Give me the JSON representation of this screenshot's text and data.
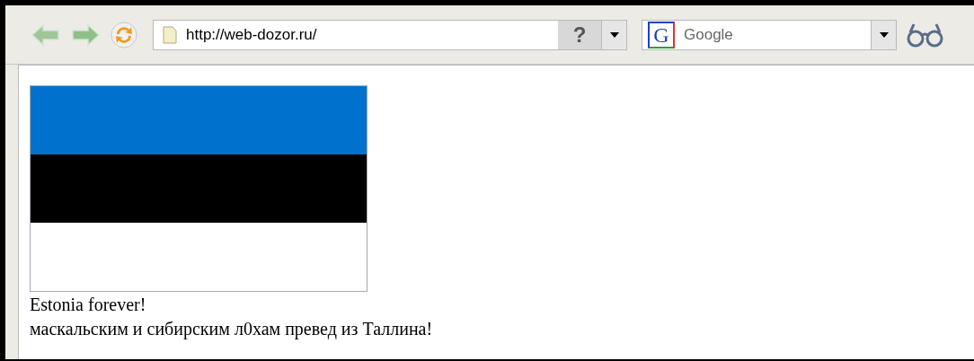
{
  "toolbar": {
    "address": "http://web-dozor.ru/",
    "help_glyph": "?",
    "search": {
      "logo_letter": "G",
      "placeholder": "Google"
    }
  },
  "page": {
    "caption": "Estonia forever!",
    "message": "маскальским и сибирским л0хам превед из Таллина!"
  }
}
